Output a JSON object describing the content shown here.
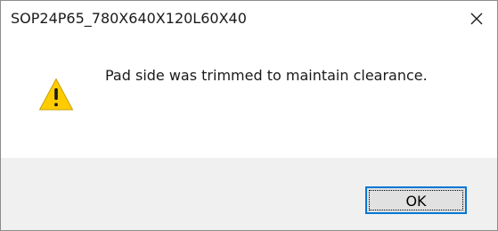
{
  "window": {
    "title": "SOP24P65_780X640X120L60X40",
    "close_icon": "close-icon"
  },
  "message": {
    "icon": "warning-icon",
    "text": "Pad side was trimmed to maintain clearance."
  },
  "buttons": {
    "ok_label": "OK"
  },
  "colors": {
    "accent": "#0078d7",
    "footer_bg": "#f0f0f0",
    "warning_fill": "#ffcc00"
  }
}
